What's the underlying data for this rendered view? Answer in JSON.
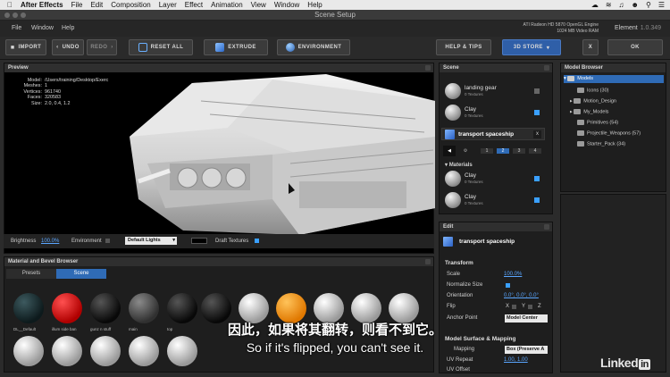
{
  "menubar": {
    "app": "After Effects",
    "items": [
      "File",
      "Edit",
      "Composition",
      "Layer",
      "Effect",
      "Animation",
      "View",
      "Window",
      "Help"
    ]
  },
  "window": {
    "title": "Scene Setup"
  },
  "plugin_menu": {
    "items": [
      "File",
      "Window",
      "Help"
    ],
    "gpu_line1": "ATI Radeon HD 5870 OpenGL Engine",
    "gpu_line2": "1024 MB Video RAM",
    "product": "Element",
    "version": "1.0.349"
  },
  "toolbar": {
    "import": "IMPORT",
    "undo": "UNDO",
    "redo": "REDO",
    "reset_all": "RESET ALL",
    "extrude": "EXTRUDE",
    "environment": "ENVIRONMENT",
    "help_tips": "HELP & TIPS",
    "store": "3D STORE",
    "close": "X",
    "ok": "OK"
  },
  "preview": {
    "title": "Preview",
    "info": [
      {
        "k": "Model:",
        "v": "/Users/training/Desktop/Exerc"
      },
      {
        "k": "Meshes:",
        "v": "1"
      },
      {
        "k": "Vertices:",
        "v": "961740"
      },
      {
        "k": "Faces:",
        "v": "320583"
      },
      {
        "k": "Size:",
        "v": "2.0, 0.4, 1.2"
      }
    ],
    "brightness_label": "Brightness",
    "brightness_value": "100.0%",
    "environment_label": "Environment",
    "lights_value": "Default Lights",
    "draft_label": "Draft Textures"
  },
  "material_browser": {
    "title": "Material and Bevel Browser",
    "tabs": [
      "Presets",
      "Scene"
    ],
    "labels": [
      "DL__Default",
      "illum side ban",
      "gunz n stuff",
      "main",
      "top",
      "",
      "",
      "",
      "",
      "",
      "",
      ""
    ]
  },
  "scene": {
    "title": "Scene",
    "items": [
      {
        "name": "landing gear",
        "sub": "0 Textures"
      },
      {
        "name": "Clay",
        "sub": "0 Textures"
      }
    ],
    "selected": "transport spaceship",
    "tab_numbers": [
      "1",
      "2",
      "3",
      "4"
    ],
    "materials_title": "Materials",
    "materials": [
      {
        "name": "Clay",
        "sub": "0 Textures"
      },
      {
        "name": "Clay",
        "sub": "0 Textures"
      }
    ]
  },
  "edit": {
    "title": "Edit",
    "object": "transport spaceship",
    "transform_title": "Transform",
    "scale_label": "Scale",
    "scale_value": "100.0%",
    "normalize_label": "Normalize Size",
    "orientation_label": "Orientation",
    "orientation_value": "0.0°, 0.0°, 0.0°",
    "flip_label": "Flip",
    "flip_axes": [
      "X",
      "Y",
      "Z"
    ],
    "anchor_label": "Anchor Point",
    "anchor_value": "Model Center",
    "surface_title": "Model Surface & Mapping",
    "mapping_label": "Mapping",
    "mapping_value": "Box (Preserve A",
    "uv_repeat_label": "UV Repeat",
    "uv_repeat_value": "1.00, 1.00",
    "uv_offset_label": "UV Offset"
  },
  "model_browser": {
    "title": "Model Browser",
    "root": "Models",
    "children": [
      "Icons (30)",
      "Motion_Design",
      "My_Models",
      "Primitives (54)",
      "Projectile_Weapons (57)",
      "Starter_Pack (34)"
    ]
  },
  "subtitles": {
    "zh": "因此，如果将其翻转，则看不到它。",
    "en": "So if it's flipped, you can't see it."
  },
  "watermark": "Linked",
  "watermark_in": "in",
  "colors": {
    "accent": "#2f6bb6",
    "check": "#3aa0ff",
    "orange": "#ff9a1a",
    "red": "#e01a1a"
  }
}
